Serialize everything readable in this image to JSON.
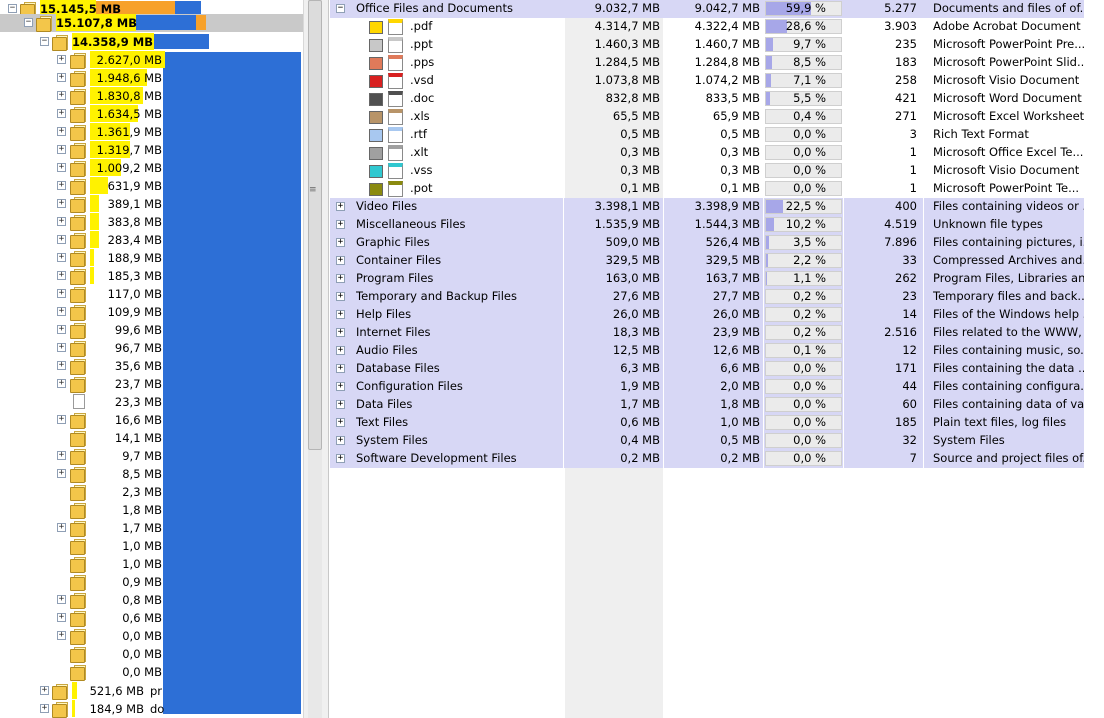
{
  "tree": {
    "top_rows": [
      {
        "size": "15.145,5 MB",
        "name": "",
        "level": 0
      },
      {
        "size": "15.107,8 MB",
        "name": "",
        "level": 1
      },
      {
        "size": "14.358,9 MB",
        "name": "",
        "level": 2
      }
    ],
    "rows": [
      {
        "size": "2.627,0 MB",
        "expandable": true,
        "type": "folder",
        "hl": 0.17
      },
      {
        "size": "1.948,6 MB",
        "expandable": true,
        "type": "folder",
        "hl": 0.13
      },
      {
        "size": "1.830,8 MB",
        "expandable": true,
        "type": "folder",
        "hl": 0.12
      },
      {
        "size": "1.634,5 MB",
        "expandable": true,
        "type": "folder",
        "hl": 0.11
      },
      {
        "size": "1.361,9 MB",
        "expandable": true,
        "type": "folder",
        "hl": 0.09
      },
      {
        "size": "1.319,7 MB",
        "expandable": true,
        "type": "folder",
        "hl": 0.09
      },
      {
        "size": "1.009,2 MB",
        "expandable": true,
        "type": "folder",
        "hl": 0.07
      },
      {
        "size": "631,9 MB",
        "expandable": true,
        "type": "folder",
        "hl": 0.04
      },
      {
        "size": "389,1 MB",
        "expandable": true,
        "type": "folder",
        "hl": 0.02
      },
      {
        "size": "383,8 MB",
        "expandable": true,
        "type": "folder",
        "hl": 0.02
      },
      {
        "size": "283,4 MB",
        "expandable": true,
        "type": "folder",
        "hl": 0.02
      },
      {
        "size": "188,9 MB",
        "expandable": true,
        "type": "folder",
        "hl": 0.01
      },
      {
        "size": "185,3 MB",
        "expandable": true,
        "type": "folder",
        "hl": 0.01
      },
      {
        "size": "117,0 MB",
        "expandable": true,
        "type": "folder",
        "hl": 0.0
      },
      {
        "size": "109,9 MB",
        "expandable": true,
        "type": "folder",
        "hl": 0.0
      },
      {
        "size": "99,6 MB",
        "expandable": true,
        "type": "folder",
        "hl": 0.0
      },
      {
        "size": "96,7 MB",
        "expandable": true,
        "type": "folder",
        "hl": 0.0
      },
      {
        "size": "35,6 MB",
        "expandable": true,
        "type": "folder",
        "hl": 0.0
      },
      {
        "size": "23,7 MB",
        "expandable": true,
        "type": "folder",
        "hl": 0.0
      },
      {
        "size": "23,3 MB",
        "expandable": false,
        "type": "file",
        "hl": 0.0
      },
      {
        "size": "16,6 MB",
        "expandable": true,
        "type": "folder",
        "hl": 0.0
      },
      {
        "size": "14,1 MB",
        "expandable": false,
        "type": "folder",
        "hl": 0.0
      },
      {
        "size": "9,7 MB",
        "expandable": true,
        "type": "folder",
        "hl": 0.0
      },
      {
        "size": "8,5 MB",
        "expandable": true,
        "type": "folder",
        "hl": 0.0
      },
      {
        "size": "2,3 MB",
        "expandable": false,
        "type": "folder",
        "hl": 0.0
      },
      {
        "size": "1,8 MB",
        "expandable": false,
        "type": "folder",
        "hl": 0.0
      },
      {
        "size": "1,7 MB",
        "expandable": true,
        "type": "folder",
        "hl": 0.0
      },
      {
        "size": "1,0 MB",
        "expandable": false,
        "type": "folder",
        "hl": 0.0
      },
      {
        "size": "1,0 MB",
        "expandable": false,
        "type": "folder",
        "hl": 0.0
      },
      {
        "size": "0,9 MB",
        "expandable": false,
        "type": "folder",
        "hl": 0.0
      },
      {
        "size": "0,8 MB",
        "expandable": true,
        "type": "folder",
        "hl": 0.0
      },
      {
        "size": "0,6 MB",
        "expandable": true,
        "type": "folder",
        "hl": 0.0
      },
      {
        "size": "0,0 MB",
        "expandable": true,
        "type": "folder",
        "hl": 0.0
      },
      {
        "size": "0,0 MB",
        "expandable": false,
        "type": "folder",
        "hl": 0.0
      },
      {
        "size": "0,0 MB",
        "expandable": false,
        "type": "folder",
        "hl": 0.0
      }
    ],
    "bottom_rows": [
      {
        "size": "521,6 MB",
        "name": "pr"
      },
      {
        "size": "184,9 MB",
        "name": "do"
      }
    ]
  },
  "table": {
    "group": {
      "name": "Office Files and Documents",
      "size": "9.032,7 MB",
      "alloc": "9.042,7 MB",
      "pct": "59,9 %",
      "pct_value": 59.9,
      "count": "5.277",
      "desc": "Documents and files of of..."
    },
    "extensions": [
      {
        "ext": ".pdf",
        "color": "#ffd700",
        "icon": "pdf-icon",
        "size": "4.314,7 MB",
        "alloc": "4.322,4 MB",
        "pct": "28,6 %",
        "pct_value": 28.6,
        "count": "3.903",
        "desc": "Adobe Acrobat Document"
      },
      {
        "ext": ".ppt",
        "color": "#c8c8c8",
        "icon": "powerpoint-icon",
        "size": "1.460,3 MB",
        "alloc": "1.460,7 MB",
        "pct": "9,7 %",
        "pct_value": 9.7,
        "count": "235",
        "desc": "Microsoft PowerPoint Pre..."
      },
      {
        "ext": ".pps",
        "color": "#e07a5a",
        "icon": "powerpoint-show-icon",
        "size": "1.284,5 MB",
        "alloc": "1.284,8 MB",
        "pct": "8,5 %",
        "pct_value": 8.5,
        "count": "183",
        "desc": "Microsoft PowerPoint Slid..."
      },
      {
        "ext": ".vsd",
        "color": "#d82020",
        "icon": "visio-icon",
        "size": "1.073,8 MB",
        "alloc": "1.074,2 MB",
        "pct": "7,1 %",
        "pct_value": 7.1,
        "count": "258",
        "desc": "Microsoft Visio Document"
      },
      {
        "ext": ".doc",
        "color": "#505050",
        "icon": "word-icon",
        "size": "832,8 MB",
        "alloc": "833,5 MB",
        "pct": "5,5 %",
        "pct_value": 5.5,
        "count": "421",
        "desc": "Microsoft Word Document"
      },
      {
        "ext": ".xls",
        "color": "#b89468",
        "icon": "excel-icon",
        "size": "65,5 MB",
        "alloc": "65,9 MB",
        "pct": "0,4 %",
        "pct_value": 0.4,
        "count": "271",
        "desc": "Microsoft Excel Worksheet"
      },
      {
        "ext": ".rtf",
        "color": "#a8c8f0",
        "icon": "rtf-icon",
        "size": "0,5 MB",
        "alloc": "0,5 MB",
        "pct": "0,0 %",
        "pct_value": 0.0,
        "count": "3",
        "desc": "Rich Text Format"
      },
      {
        "ext": ".xlt",
        "color": "#a0a0a0",
        "icon": "excel-template-icon",
        "size": "0,3 MB",
        "alloc": "0,3 MB",
        "pct": "0,0 %",
        "pct_value": 0.0,
        "count": "1",
        "desc": "Microsoft Office Excel Te..."
      },
      {
        "ext": ".vss",
        "color": "#30c8d0",
        "icon": "visio-stencil-icon",
        "size": "0,3 MB",
        "alloc": "0,3 MB",
        "pct": "0,0 %",
        "pct_value": 0.0,
        "count": "1",
        "desc": "Microsoft Visio Document"
      },
      {
        "ext": ".pot",
        "color": "#8a8a10",
        "icon": "powerpoint-template-icon",
        "size": "0,1 MB",
        "alloc": "0,1 MB",
        "pct": "0,0 %",
        "pct_value": 0.0,
        "count": "1",
        "desc": "Microsoft PowerPoint Te..."
      }
    ],
    "categories": [
      {
        "name": "Video Files",
        "size": "3.398,1 MB",
        "alloc": "3.398,9 MB",
        "pct": "22,5 %",
        "pct_value": 22.5,
        "count": "400",
        "desc": "Files containing videos or ..."
      },
      {
        "name": "Miscellaneous Files",
        "size": "1.535,9 MB",
        "alloc": "1.544,3 MB",
        "pct": "10,2 %",
        "pct_value": 10.2,
        "count": "4.519",
        "desc": "Unknown file types"
      },
      {
        "name": "Graphic Files",
        "size": "509,0 MB",
        "alloc": "526,4 MB",
        "pct": "3,5 %",
        "pct_value": 3.5,
        "count": "7.896",
        "desc": "Files containing pictures, i..."
      },
      {
        "name": "Container Files",
        "size": "329,5 MB",
        "alloc": "329,5 MB",
        "pct": "2,2 %",
        "pct_value": 2.2,
        "count": "33",
        "desc": "Compressed Archives and..."
      },
      {
        "name": "Program Files",
        "size": "163,0 MB",
        "alloc": "163,7 MB",
        "pct": "1,1 %",
        "pct_value": 1.1,
        "count": "262",
        "desc": "Program Files, Libraries an..."
      },
      {
        "name": "Temporary and Backup Files",
        "size": "27,6 MB",
        "alloc": "27,7 MB",
        "pct": "0,2 %",
        "pct_value": 0.2,
        "count": "23",
        "desc": "Temporary files and back..."
      },
      {
        "name": "Help Files",
        "size": "26,0 MB",
        "alloc": "26,0 MB",
        "pct": "0,2 %",
        "pct_value": 0.2,
        "count": "14",
        "desc": "Files of the Windows help ..."
      },
      {
        "name": "Internet Files",
        "size": "18,3 MB",
        "alloc": "23,9 MB",
        "pct": "0,2 %",
        "pct_value": 0.2,
        "count": "2.516",
        "desc": "Files related to the WWW, ..."
      },
      {
        "name": "Audio Files",
        "size": "12,5 MB",
        "alloc": "12,6 MB",
        "pct": "0,1 %",
        "pct_value": 0.1,
        "count": "12",
        "desc": "Files containing music, so..."
      },
      {
        "name": "Database Files",
        "size": "6,3 MB",
        "alloc": "6,6 MB",
        "pct": "0,0 %",
        "pct_value": 0.0,
        "count": "171",
        "desc": "Files containing the data ..."
      },
      {
        "name": "Configuration Files",
        "size": "1,9 MB",
        "alloc": "2,0 MB",
        "pct": "0,0 %",
        "pct_value": 0.0,
        "count": "44",
        "desc": "Files containing configura..."
      },
      {
        "name": "Data Files",
        "size": "1,7 MB",
        "alloc": "1,8 MB",
        "pct": "0,0 %",
        "pct_value": 0.0,
        "count": "60",
        "desc": "Files containing data of va..."
      },
      {
        "name": "Text Files",
        "size": "0,6 MB",
        "alloc": "1,0 MB",
        "pct": "0,0 %",
        "pct_value": 0.0,
        "count": "185",
        "desc": "Plain text files, log files"
      },
      {
        "name": "System Files",
        "size": "0,4 MB",
        "alloc": "0,5 MB",
        "pct": "0,0 %",
        "pct_value": 0.0,
        "count": "32",
        "desc": "System Files"
      },
      {
        "name": "Software Development Files",
        "size": "0,2 MB",
        "alloc": "0,2 MB",
        "pct": "0,0 %",
        "pct_value": 0.0,
        "count": "7",
        "desc": "Source and project files of..."
      }
    ]
  },
  "colors": {
    "folder_yellow": "#f3c64a",
    "highlight_yellow": "#fff200",
    "bar_blue": "#2d6fd6",
    "bar_orange": "#f7a12a",
    "category_row": "#d7d7f5",
    "percent_fill": "#a7a7e8"
  }
}
